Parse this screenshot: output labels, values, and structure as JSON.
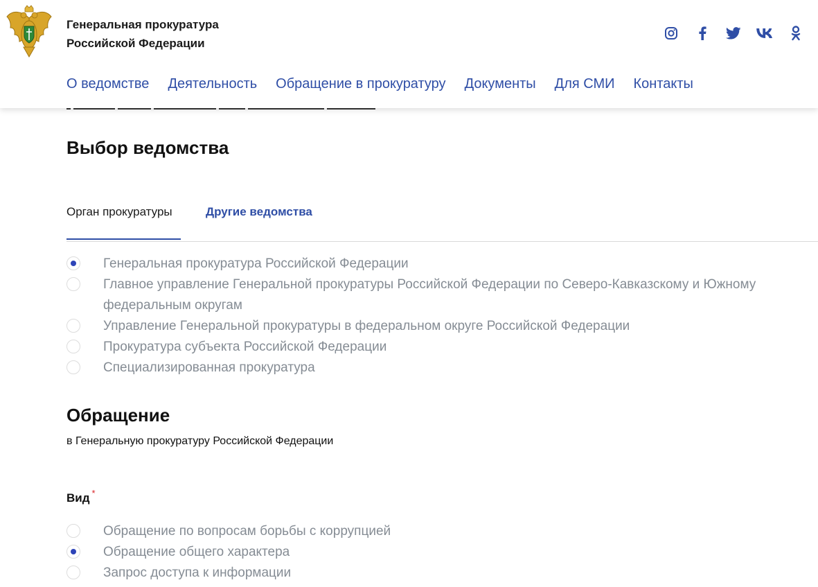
{
  "header": {
    "org_name_line1": "Генеральная прокуратура",
    "org_name_line2": "Российской Федерации",
    "social": [
      {
        "name": "instagram-icon"
      },
      {
        "name": "facebook-icon"
      },
      {
        "name": "twitter-icon"
      },
      {
        "name": "vk-icon"
      },
      {
        "name": "odnoklassniki-icon"
      }
    ],
    "nav": [
      "О ведомстве",
      "Деятельность",
      "Обращение в прокуратуру",
      "Документы",
      "Для СМИ",
      "Контакты"
    ]
  },
  "department": {
    "title": "Выбор ведомства",
    "tabs": {
      "active": "Орган прокуратуры",
      "other": "Другие ведомства"
    },
    "options": [
      {
        "label": "Генеральная прокуратура Российской Федерации",
        "selected": true
      },
      {
        "label": "Главное управление Генеральной прокуратуры Российской Федерации по Северо-Кавказскому и Южному федеральным округам",
        "selected": false
      },
      {
        "label": "Управление Генеральной прокуратуры в федеральном округе Российской Федерации",
        "selected": false
      },
      {
        "label": "Прокуратура субъекта Российской Федерации",
        "selected": false
      },
      {
        "label": "Специализированная прокуратура",
        "selected": false
      }
    ]
  },
  "appeal": {
    "title": "Обращение",
    "subtitle": "в Генеральную прокуратуру Российской Федерации",
    "type_label": "Вид",
    "required_mark": "*",
    "types": [
      {
        "label": "Обращение по вопросам борьбы с коррупцией",
        "selected": false
      },
      {
        "label": "Обращение общего характера",
        "selected": true
      },
      {
        "label": "Запрос доступа к информации",
        "selected": false
      }
    ]
  },
  "colors": {
    "accent": "#2f4ea6",
    "radio_dot": "#2e44b8",
    "option_text": "#858c94",
    "required": "#d9252a"
  }
}
